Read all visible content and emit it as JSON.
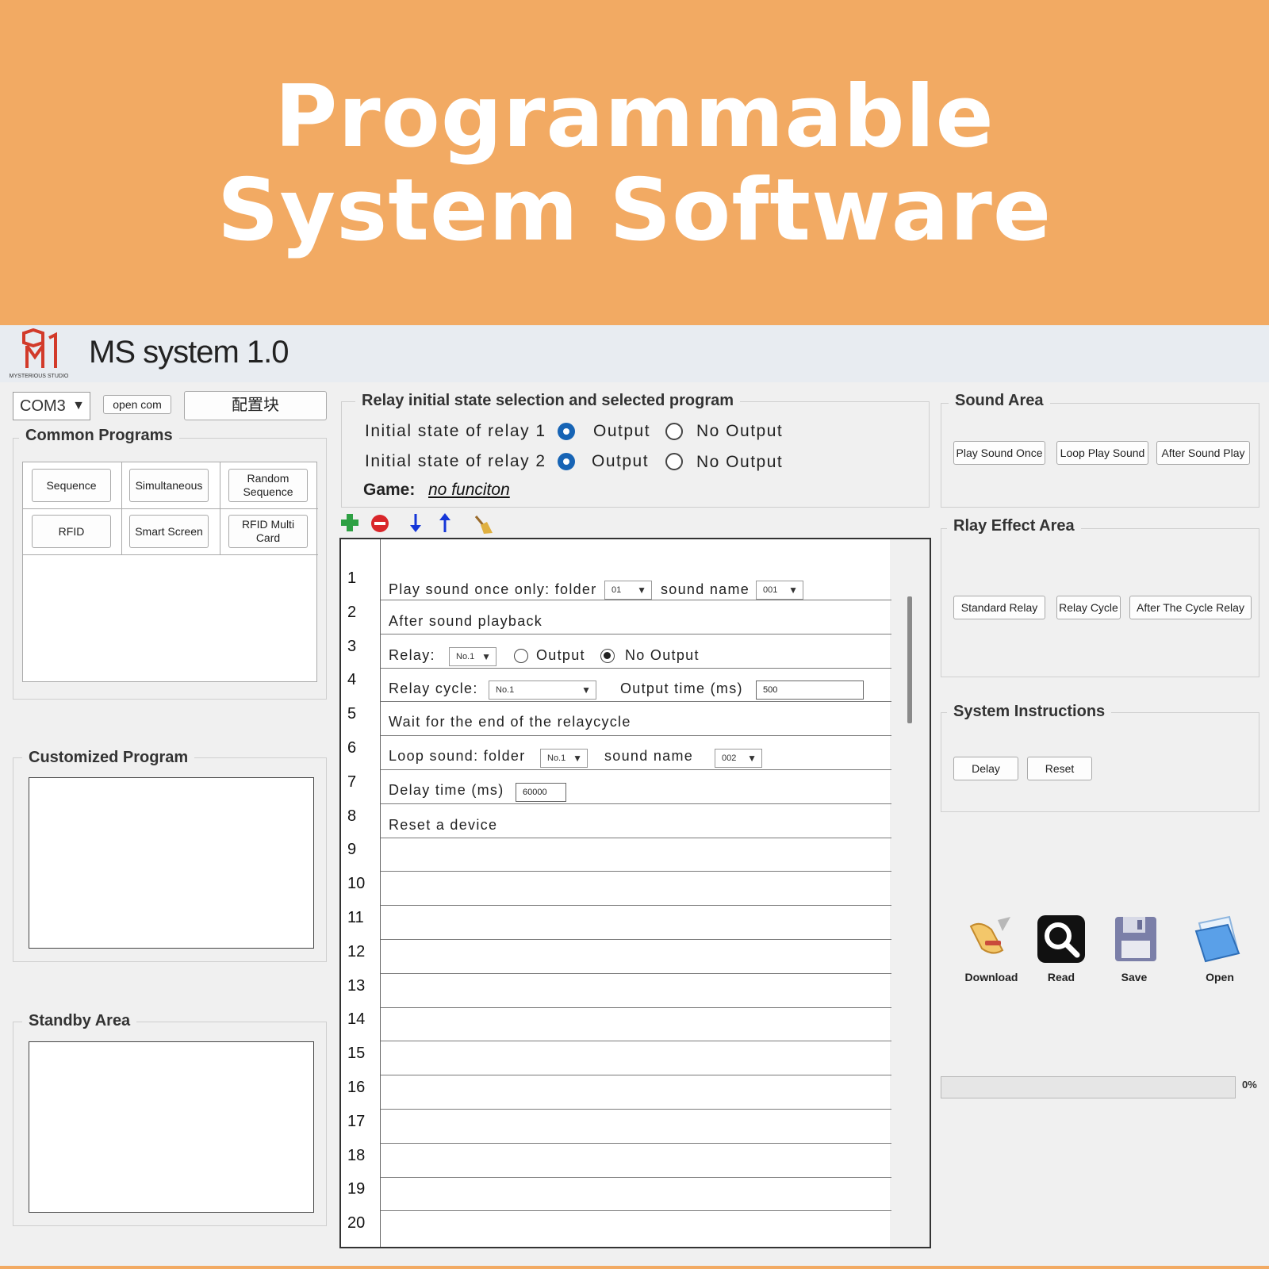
{
  "banner": {
    "line1": "Programmable",
    "line2": "System Software"
  },
  "app": {
    "logo_text": "MYSTERIOUS STUDIO",
    "title": "MS system 1.0"
  },
  "toolbar_top": {
    "port": "COM3",
    "open_com": "open com",
    "config": "配置块"
  },
  "common_programs": {
    "title": "Common Programs",
    "buttons": [
      "Sequence",
      "Simultaneous",
      "Random Sequence",
      "RFID",
      "Smart Screen",
      "RFID Multi Card"
    ]
  },
  "customized_program": {
    "title": "Customized Program"
  },
  "standby_area": {
    "title": "Standby Area"
  },
  "relay_selection": {
    "title": "Relay initial state selection and selected program",
    "relay1_label": "Initial state of relay 1",
    "relay2_label": "Initial state of relay 2",
    "output": "Output",
    "no_output": "No Output",
    "relay1_selected": "Output",
    "relay2_selected": "Output",
    "game_label": "Game:",
    "game_value": "no funciton"
  },
  "list_tools": [
    "add-icon",
    "remove-icon",
    "move-down-icon",
    "move-up-icon",
    "clear-broom-icon"
  ],
  "program_rows": {
    "numbers": [
      "1",
      "2",
      "3",
      "4",
      "5",
      "6",
      "7",
      "8",
      "9",
      "10",
      "11",
      "12",
      "13",
      "14",
      "15",
      "16",
      "17",
      "18",
      "19",
      "20"
    ],
    "r1": {
      "text": "Play sound once only: folder",
      "folder": "01",
      "sound_label": "sound name",
      "sound": "001"
    },
    "r2": {
      "text": "After sound playback"
    },
    "r3": {
      "label": "Relay:",
      "relay": "No.1",
      "output": "Output",
      "no_output": "No Output",
      "selected": "No Output"
    },
    "r4": {
      "label": "Relay cycle:",
      "relay": "No.1",
      "time_label": "Output time (ms)",
      "time": "500"
    },
    "r5": {
      "text": "Wait for the end of the relaycycle"
    },
    "r6": {
      "text": "Loop sound: folder",
      "folder": "No.1",
      "sound_label": "sound name",
      "sound": "002"
    },
    "r7": {
      "label": "Delay time (ms)",
      "time": "60000"
    },
    "r8": {
      "text": "Reset a device"
    }
  },
  "sound_area": {
    "title": "Sound Area",
    "buttons": [
      "Play Sound Once",
      "Loop Play Sound",
      "After Sound Play"
    ]
  },
  "relay_effect_area": {
    "title": "Rlay Effect Area",
    "buttons": [
      "Standard Relay",
      "Relay Cycle",
      "After The Cycle Relay"
    ]
  },
  "system_instructions": {
    "title": "System Instructions",
    "buttons": [
      "Delay",
      "Reset"
    ]
  },
  "actions": {
    "download": "Download",
    "read": "Read",
    "save": "Save",
    "open": "Open"
  },
  "progress": {
    "value": 0,
    "label": "0%"
  },
  "colors": {
    "banner": "#f2aa63",
    "radio_selected": "#1764b5",
    "window_bg": "#f0f0f0"
  }
}
